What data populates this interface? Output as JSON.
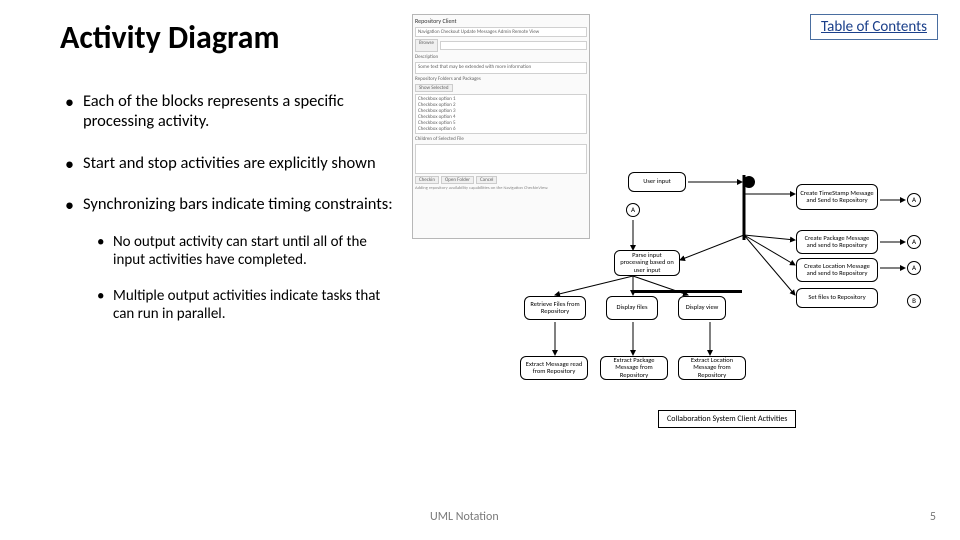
{
  "title": "Activity Diagram",
  "toc_link": "Table of Contents",
  "bullets": {
    "b1": "Each of the blocks represents a specific processing activity.",
    "b2": "Start and stop activities are explicitly shown",
    "b3": "Synchronizing bars indicate timing constraints:",
    "sub1": "No output activity can start until all of the input activities have completed.",
    "sub2": "Multiple output activities indicate tasks that can run in parallel."
  },
  "panel": {
    "titlebar": "Repository Client",
    "tabs": "Navigation  Checkout  Update  Messages  Admin  Remote View",
    "browse": "Browse",
    "desc_label": "Description",
    "desc_text": "Some text that may be extended with more information",
    "folder_label": "Repository Folders and Packages",
    "show_btn": "Show Selected",
    "chk1": "Checkbox option 1",
    "chk2": "Checkbox option 2",
    "chk3": "Checkbox option 3",
    "chk4": "Checkbox option 4",
    "chk5": "Checkbox option 5",
    "chk6": "Checkbox option 6",
    "children_label": "Children of Selected File",
    "checkin": "Checkin",
    "open": "Open Folder",
    "cancel": "Cancel",
    "note": "Adding repository availability capabilities on the Navigation CheckInView."
  },
  "diagram": {
    "userinput": "User input",
    "act1": "Create TimeStamp Message and Send to Repository",
    "act2": "Parse input processing based on user input",
    "act3": "Create Package Message and send to Repository",
    "act4": "Create Location Message and send to Repository",
    "act5": "Retrieve Files from Repository",
    "act6": "Display files",
    "act7": "Display view",
    "act8": "Set files to Repository",
    "act9": "Extract Message read from Repository",
    "act10": "Extract Package Message from Repository",
    "act11": "Extract Location Message from Repository",
    "title": "Collaboration System Client Activities",
    "lblA": "A",
    "lblB": "B"
  },
  "footer": {
    "label": "UML Notation",
    "page": "5"
  }
}
